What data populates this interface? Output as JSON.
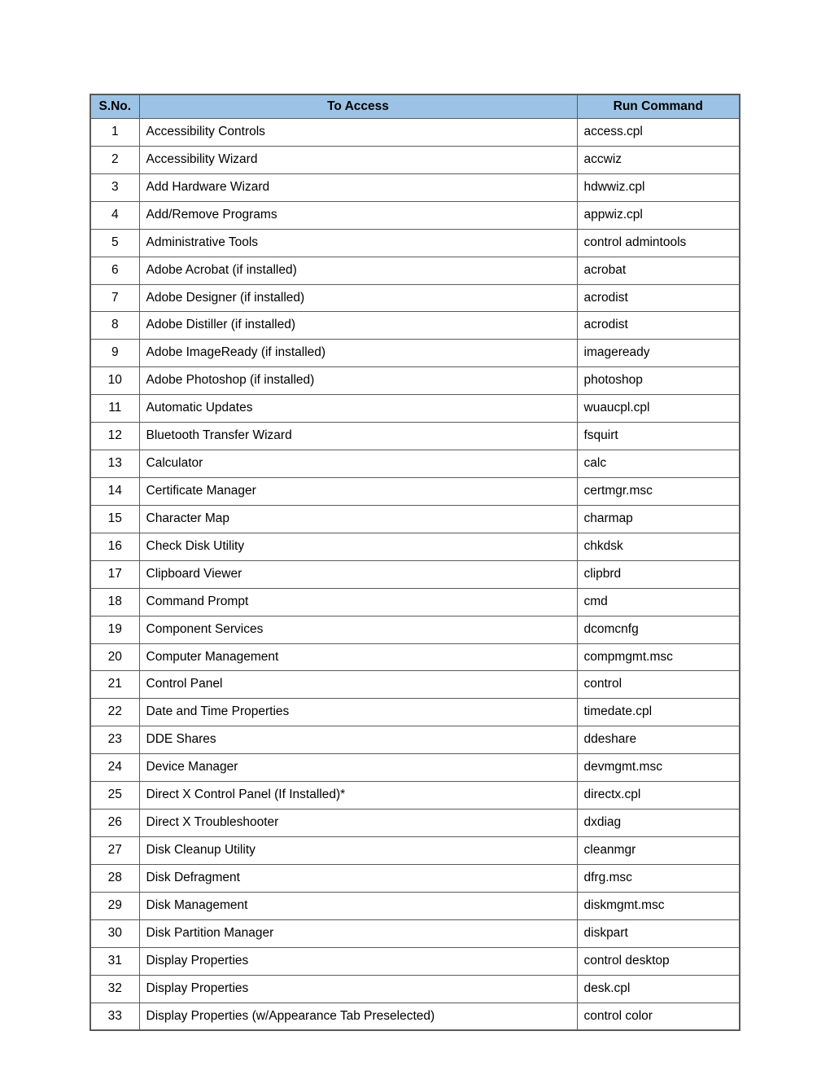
{
  "table": {
    "headers": {
      "sno": "S.No.",
      "access": "To Access",
      "cmd": "Run Command"
    },
    "rows": [
      {
        "sno": "1",
        "access": "Accessibility Controls",
        "cmd": "access.cpl"
      },
      {
        "sno": "2",
        "access": "Accessibility Wizard",
        "cmd": "accwiz"
      },
      {
        "sno": "3",
        "access": "Add Hardware Wizard",
        "cmd": "hdwwiz.cpl"
      },
      {
        "sno": "4",
        "access": "Add/Remove Programs",
        "cmd": "appwiz.cpl"
      },
      {
        "sno": "5",
        "access": "Administrative Tools",
        "cmd": "control admintools"
      },
      {
        "sno": "6",
        "access": "Adobe Acrobat (if installed)",
        "cmd": "acrobat"
      },
      {
        "sno": "7",
        "access": "Adobe Designer (if installed)",
        "cmd": "acrodist"
      },
      {
        "sno": "8",
        "access": "Adobe Distiller (if installed)",
        "cmd": "acrodist"
      },
      {
        "sno": "9",
        "access": "Adobe ImageReady (if installed)",
        "cmd": "imageready"
      },
      {
        "sno": "10",
        "access": "Adobe Photoshop (if installed)",
        "cmd": "photoshop"
      },
      {
        "sno": "11",
        "access": "Automatic Updates",
        "cmd": "wuaucpl.cpl"
      },
      {
        "sno": "12",
        "access": "Bluetooth Transfer Wizard",
        "cmd": "fsquirt"
      },
      {
        "sno": "13",
        "access": "Calculator",
        "cmd": "calc"
      },
      {
        "sno": "14",
        "access": "Certificate Manager",
        "cmd": "certmgr.msc"
      },
      {
        "sno": "15",
        "access": "Character Map",
        "cmd": "charmap"
      },
      {
        "sno": "16",
        "access": "Check Disk Utility",
        "cmd": "chkdsk"
      },
      {
        "sno": "17",
        "access": "Clipboard Viewer",
        "cmd": "clipbrd"
      },
      {
        "sno": "18",
        "access": "Command Prompt",
        "cmd": "cmd"
      },
      {
        "sno": "19",
        "access": "Component Services",
        "cmd": "dcomcnfg"
      },
      {
        "sno": "20",
        "access": "Computer Management",
        "cmd": "compmgmt.msc"
      },
      {
        "sno": "21",
        "access": "Control Panel",
        "cmd": "control"
      },
      {
        "sno": "22",
        "access": "Date and Time Properties",
        "cmd": "timedate.cpl"
      },
      {
        "sno": "23",
        "access": "DDE Shares",
        "cmd": "ddeshare"
      },
      {
        "sno": "24",
        "access": "Device Manager",
        "cmd": "devmgmt.msc"
      },
      {
        "sno": "25",
        "access": "Direct X Control Panel (If Installed)*",
        "cmd": "directx.cpl"
      },
      {
        "sno": "26",
        "access": "Direct X Troubleshooter",
        "cmd": "dxdiag"
      },
      {
        "sno": "27",
        "access": "Disk Cleanup Utility",
        "cmd": "cleanmgr"
      },
      {
        "sno": "28",
        "access": "Disk Defragment",
        "cmd": "dfrg.msc"
      },
      {
        "sno": "29",
        "access": "Disk Management",
        "cmd": "diskmgmt.msc"
      },
      {
        "sno": "30",
        "access": "Disk Partition Manager",
        "cmd": "diskpart"
      },
      {
        "sno": "31",
        "access": "Display Properties",
        "cmd": "control desktop"
      },
      {
        "sno": "32",
        "access": "Display Properties",
        "cmd": "desk.cpl"
      },
      {
        "sno": "33",
        "access": "Display Properties (w/Appearance Tab Preselected)",
        "cmd": "control color"
      }
    ]
  }
}
